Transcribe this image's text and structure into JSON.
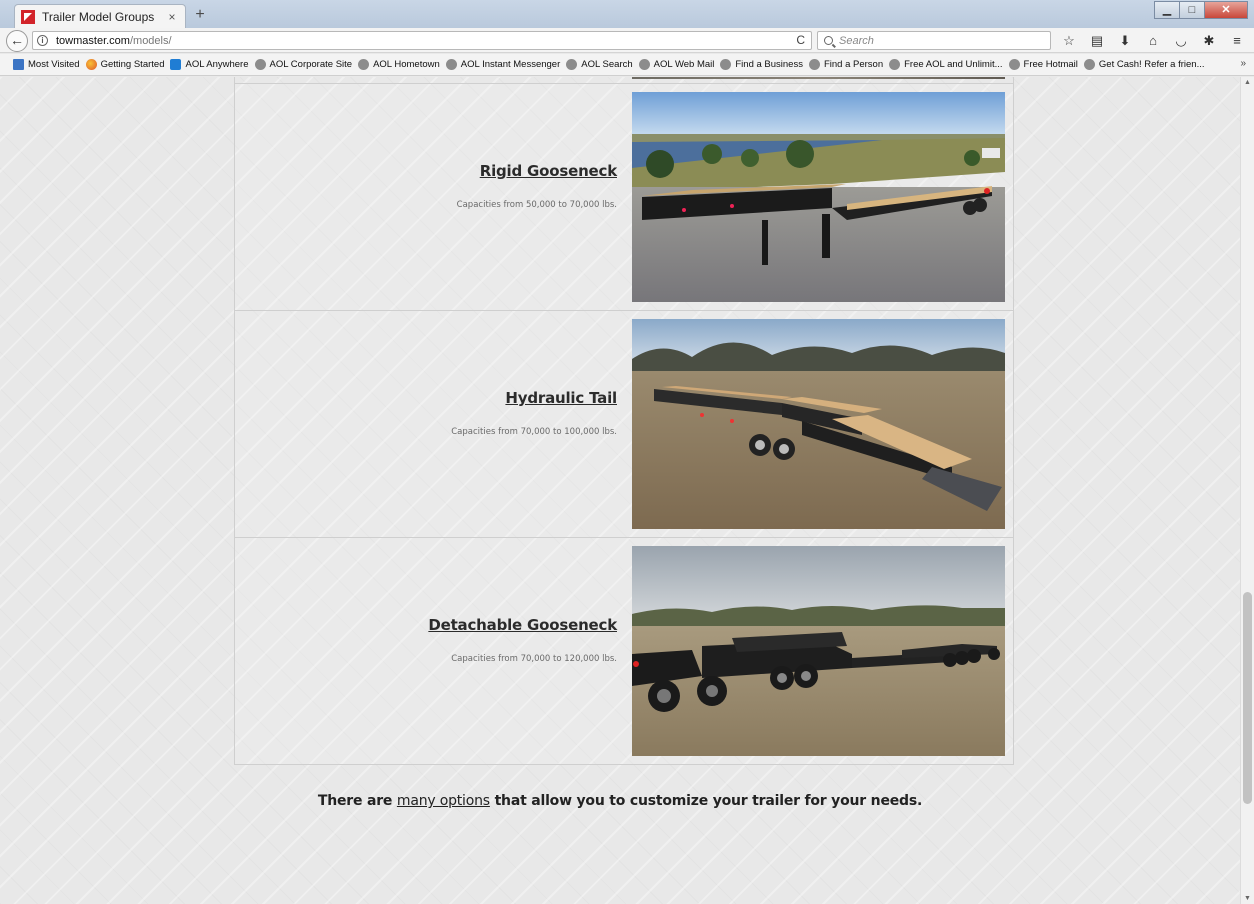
{
  "browser": {
    "tab_title": "Trailer Model Groups",
    "tab_close": "×",
    "new_tab": "+",
    "url_domain": "towmaster.com",
    "url_path": "/models/",
    "search_placeholder": "Search",
    "window_controls": [
      "minimize",
      "maximize",
      "close"
    ],
    "toolbar_icons": [
      "star-icon",
      "clipboard-icon",
      "download-icon",
      "home-icon",
      "pocket-icon",
      "extension-icon",
      "menu-icon"
    ]
  },
  "bookmarks": [
    {
      "label": "Most Visited",
      "icon": "sq"
    },
    {
      "label": "Getting Started",
      "icon": "ff"
    },
    {
      "label": "AOL Anywhere",
      "icon": "aol"
    },
    {
      "label": "AOL Corporate Site",
      "icon": "globe"
    },
    {
      "label": "AOL Hometown",
      "icon": "globe"
    },
    {
      "label": "AOL Instant Messenger",
      "icon": "globe"
    },
    {
      "label": "AOL Search",
      "icon": "globe"
    },
    {
      "label": "AOL Web Mail",
      "icon": "globe"
    },
    {
      "label": "Find a Business",
      "icon": "globe"
    },
    {
      "label": "Find a Person",
      "icon": "globe"
    },
    {
      "label": "Free AOL and Unlimit...",
      "icon": "globe"
    },
    {
      "label": "Free Hotmail",
      "icon": "globe"
    },
    {
      "label": "Get Cash! Refer a frien...",
      "icon": "globe"
    }
  ],
  "models": [
    {
      "title": "Rigid Gooseneck",
      "capacity": "Capacities from 50,000 to 70,000 lbs."
    },
    {
      "title": "Hydraulic Tail",
      "capacity": "Capacities from 70,000 to 100,000 lbs."
    },
    {
      "title": "Detachable Gooseneck",
      "capacity": "Capacities from 70,000 to 120,000 lbs."
    }
  ],
  "footer": {
    "before": "There are ",
    "link": "many options",
    "after": " that allow you to customize your trailer for your needs."
  },
  "colors": {
    "accent": "#d2232a",
    "page_bg": "#e8e8e8"
  }
}
